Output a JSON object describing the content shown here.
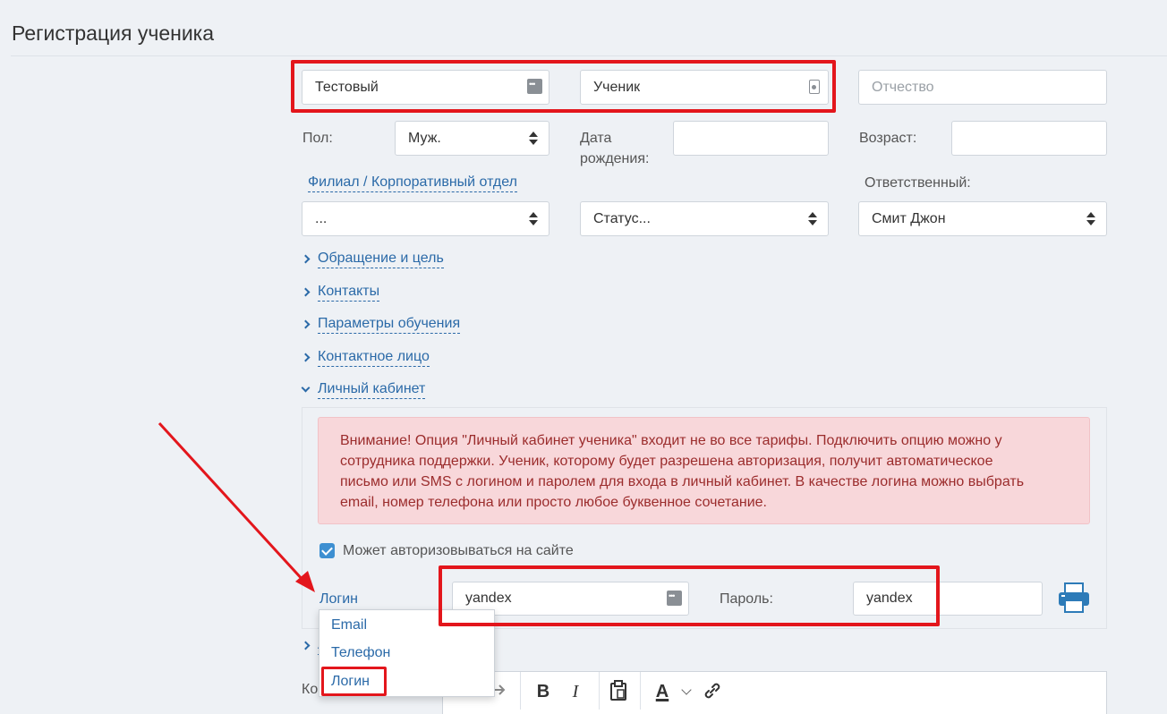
{
  "page_title": "Регистрация ученика",
  "name_fields": {
    "first_name": "Тестовый",
    "last_name": "Ученик",
    "middle_name_placeholder": "Отчество"
  },
  "gender": {
    "label": "Пол:",
    "value": "Муж."
  },
  "birth_date": {
    "label_line1": "Дата",
    "label_line2": "рождения:",
    "value": ""
  },
  "age": {
    "label": "Возраст:",
    "value": ""
  },
  "branch": {
    "link": "Филиал / Корпоративный отдел",
    "value": "..."
  },
  "status": {
    "value": "Статус..."
  },
  "responsible": {
    "label": "Ответственный:",
    "value": "Смит Джон"
  },
  "sections": [
    {
      "label": "Обращение и цель"
    },
    {
      "label": "Контакты"
    },
    {
      "label": "Параметры обучения"
    },
    {
      "label": "Контактное лицо"
    },
    {
      "label": "Личный кабинет"
    }
  ],
  "cabinet": {
    "alert_line1": "Внимание! Опция \"Личный кабинет ученика\" входит не во все тарифы. Подключить опцию можно у",
    "alert_line2": "сотрудника поддержки. Ученик, которому будет разрешена авторизация, получит автоматическое",
    "alert_line3": "письмо или SMS с логином и паролем для входа в личный кабинет. В качестве логина можно выбрать",
    "alert_line4": "email, номер телефона или просто любое буквенное сочетание.",
    "auth_label": "Может авторизовываться на сайте",
    "login_type_label": "Логин",
    "login_value": "yandex",
    "password_label": "Пароль:",
    "password_value": "yandex"
  },
  "login_dropdown": {
    "options": [
      "Email",
      "Телефон",
      "Логин"
    ]
  },
  "hidden_fragments": {
    "section_partial": "А",
    "comment_partial": "Ко"
  },
  "toolbar": {
    "bold": "B",
    "italic": "I",
    "text_color": "A"
  },
  "colors": {
    "accent": "#2b6aa8",
    "annotation_red": "#e3161c",
    "alert_bg": "#f8d7da",
    "alert_text": "#9b2c2c",
    "checkbox": "#3d8fd1"
  }
}
